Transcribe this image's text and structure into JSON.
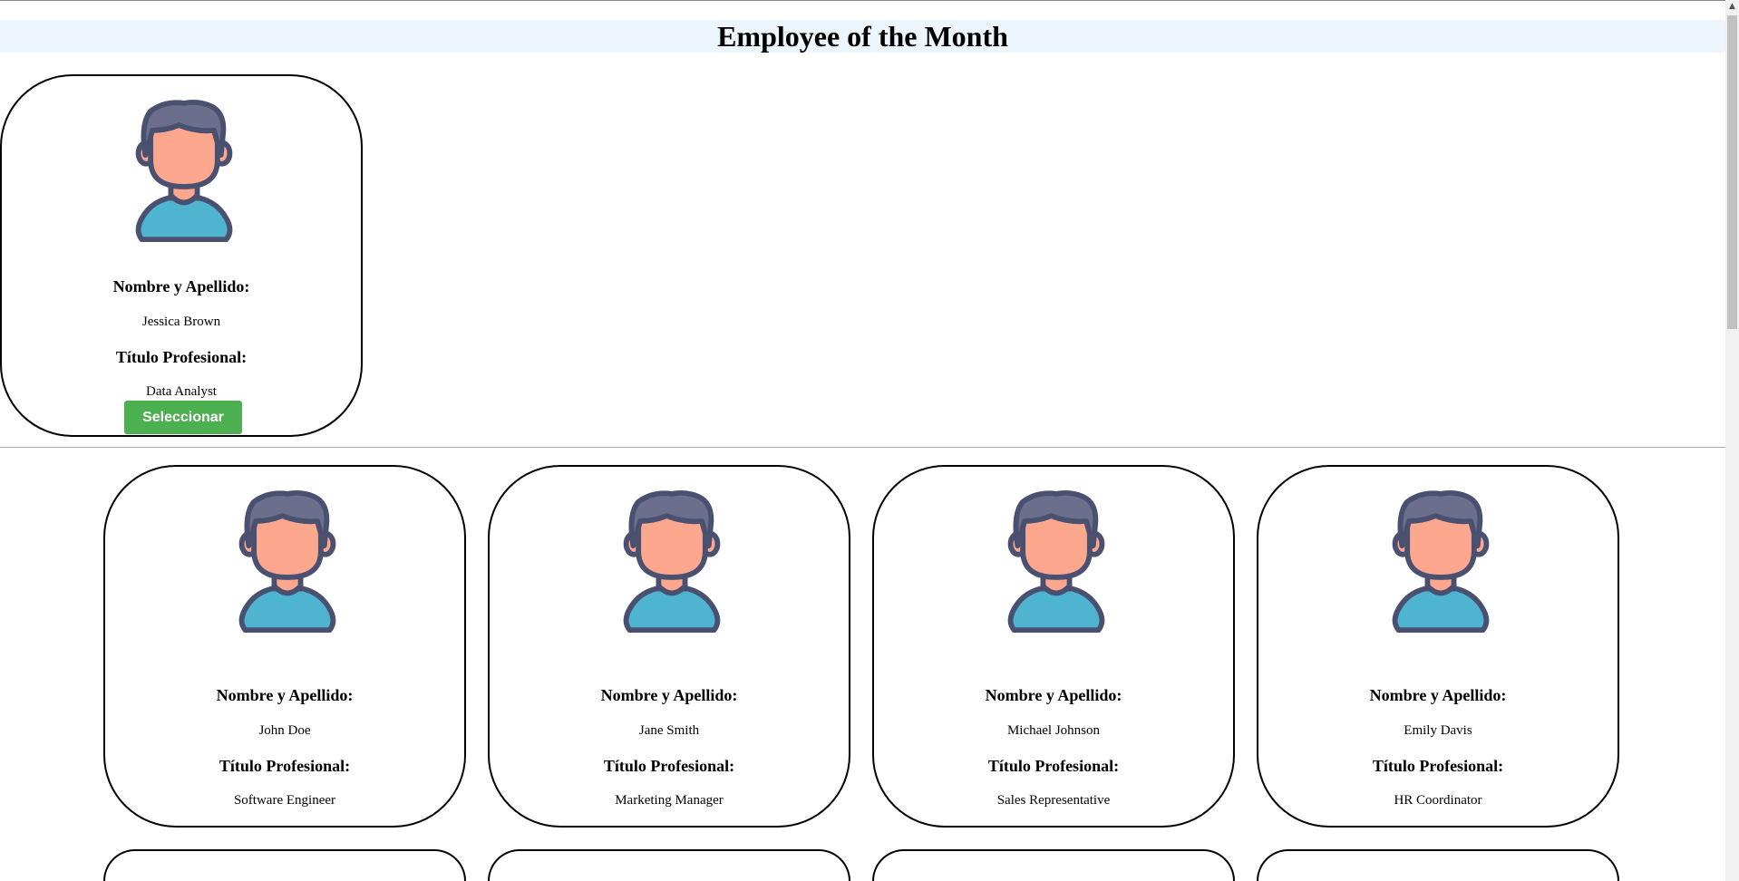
{
  "header": {
    "title": "Employee of the Month"
  },
  "labels": {
    "name": "Nombre y Apellido:",
    "title": "Título Profesional:"
  },
  "selected": {
    "name": "Jessica Brown",
    "title": "Data Analyst",
    "button": "Seleccionar"
  },
  "employees": [
    {
      "name": "John Doe",
      "title": "Software Engineer"
    },
    {
      "name": "Jane Smith",
      "title": "Marketing Manager"
    },
    {
      "name": "Michael Johnson",
      "title": "Sales Representative"
    },
    {
      "name": "Emily Davis",
      "title": "HR Coordinator"
    }
  ],
  "icons": {
    "avatar": "user-avatar-icon",
    "scroll_up": "scroll-up-arrow-icon"
  },
  "colors": {
    "header_bg": "#eef6fd",
    "button_bg": "#4caf50",
    "avatar_hair": "#6b6f8c",
    "avatar_skin": "#fda78f",
    "avatar_shirt": "#4fb4cf",
    "avatar_outline": "#4a5070"
  }
}
